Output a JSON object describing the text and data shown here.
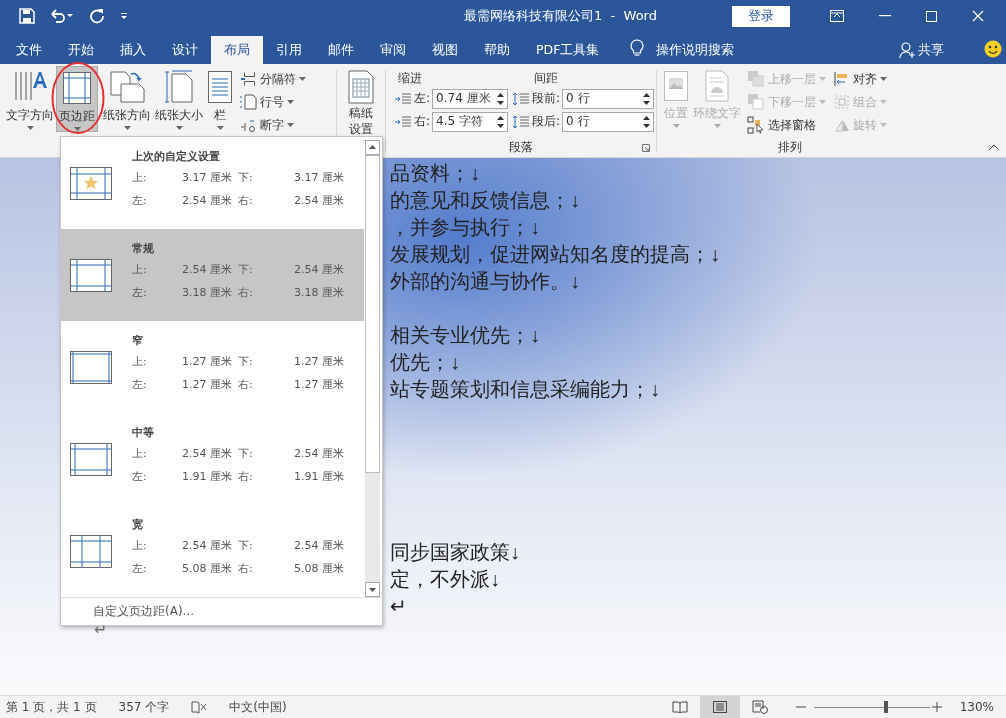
{
  "window": {
    "title": "最需网络科技有限公司1  -  Word",
    "sign_in": "登录"
  },
  "tabs": [
    {
      "label": "文件",
      "selected": false
    },
    {
      "label": "开始",
      "selected": false
    },
    {
      "label": "插入",
      "selected": false
    },
    {
      "label": "设计",
      "selected": false
    },
    {
      "label": "布局",
      "selected": true
    },
    {
      "label": "引用",
      "selected": false
    },
    {
      "label": "邮件",
      "selected": false
    },
    {
      "label": "审阅",
      "selected": false
    },
    {
      "label": "视图",
      "selected": false
    },
    {
      "label": "帮助",
      "selected": false
    },
    {
      "label": "PDF工具集",
      "selected": false
    }
  ],
  "tell_me": "操作说明搜索",
  "share": "共享",
  "page_setup": {
    "big_buttons": [
      {
        "label": "文字方向",
        "kind": "text-direction",
        "pressed": false
      },
      {
        "label": "页边距",
        "kind": "margins",
        "pressed": true
      },
      {
        "label": "纸张方向",
        "kind": "orientation",
        "pressed": false
      },
      {
        "label": "纸张大小",
        "kind": "size",
        "pressed": false
      },
      {
        "label": "栏",
        "kind": "columns",
        "pressed": false
      }
    ],
    "small_buttons": [
      {
        "label": "分隔符",
        "kind": "breaks"
      },
      {
        "label": "行号",
        "kind": "line-numbers"
      },
      {
        "label": "断字",
        "kind": "hyphenation"
      }
    ]
  },
  "manuscript": {
    "lines": [
      "稿纸",
      "设置"
    ]
  },
  "paragraph": {
    "title": "段落",
    "indent": {
      "label": "缩进",
      "fields": [
        {
          "label": "左:",
          "value": "0.74 厘米"
        },
        {
          "label": "右:",
          "value": "4.5 字符"
        }
      ]
    },
    "spacing": {
      "label": "间距",
      "fields": [
        {
          "label": "段前:",
          "value": "0 行"
        },
        {
          "label": "段后:",
          "value": "0 行"
        }
      ]
    }
  },
  "arrange": {
    "title": "排列",
    "big_buttons": [
      {
        "label": "位置",
        "kind": "position",
        "disabled": true
      },
      {
        "label": "环绕文字",
        "kind": "wrap",
        "disabled": true
      }
    ],
    "small_buttons": [
      {
        "label": "上移一层",
        "kind": "forward",
        "disabled": true
      },
      {
        "label": "下移一层",
        "kind": "backward",
        "disabled": true
      },
      {
        "label": "选择窗格",
        "kind": "pane",
        "disabled": false
      }
    ],
    "small_buttons_2": [
      {
        "label": "对齐",
        "kind": "align",
        "disabled": false
      },
      {
        "label": "组合",
        "kind": "group",
        "disabled": true
      },
      {
        "label": "旋转",
        "kind": "rotate",
        "disabled": true
      }
    ]
  },
  "margins_menu": {
    "items": [
      {
        "name": "上次的自定义设置",
        "kind": "custom",
        "selected": false,
        "fields": [
          {
            "label": "上:",
            "value": "3.17 厘米"
          },
          {
            "label": "下:",
            "value": "3.17 厘米"
          },
          {
            "label": "左:",
            "value": "2.54 厘米"
          },
          {
            "label": "右:",
            "value": "2.54 厘米"
          }
        ]
      },
      {
        "name": "常规",
        "kind": "normal",
        "selected": true,
        "fields": [
          {
            "label": "上:",
            "value": "2.54 厘米"
          },
          {
            "label": "下:",
            "value": "2.54 厘米"
          },
          {
            "label": "左:",
            "value": "3.18 厘米"
          },
          {
            "label": "右:",
            "value": "3.18 厘米"
          }
        ]
      },
      {
        "name": "窄",
        "kind": "narrow",
        "selected": false,
        "fields": [
          {
            "label": "上:",
            "value": "1.27 厘米"
          },
          {
            "label": "下:",
            "value": "1.27 厘米"
          },
          {
            "label": "左:",
            "value": "1.27 厘米"
          },
          {
            "label": "右:",
            "value": "1.27 厘米"
          }
        ]
      },
      {
        "name": "中等",
        "kind": "moderate",
        "selected": false,
        "fields": [
          {
            "label": "上:",
            "value": "2.54 厘米"
          },
          {
            "label": "下:",
            "value": "2.54 厘米"
          },
          {
            "label": "左:",
            "value": "1.91 厘米"
          },
          {
            "label": "右:",
            "value": "1.91 厘米"
          }
        ]
      },
      {
        "name": "宽",
        "kind": "wide",
        "selected": false,
        "fields": [
          {
            "label": "上:",
            "value": "2.54 厘米"
          },
          {
            "label": "下:",
            "value": "2.54 厘米"
          },
          {
            "label": "左:",
            "value": "5.08 厘米"
          },
          {
            "label": "右:",
            "value": "5.08 厘米"
          }
        ]
      }
    ],
    "footer": "自定义页边距(A)..."
  },
  "document": {
    "blocks": [
      [
        "品资料；↓",
        "的意见和反馈信息；↓",
        "，并参与执行；↓",
        "发展规划，促进网站知名度的提高；↓",
        "外部的沟通与协作。↓"
      ],
      [
        "相关专业优先；↓",
        "优先；↓",
        "站专题策划和信息采编能力；↓"
      ],
      [
        "同步国家政策↓",
        "定，不外派↓",
        "↵"
      ]
    ],
    "end_mark": "↵"
  },
  "status_bar": {
    "page": "第 1 页，共 1 页",
    "words": "357 个字",
    "language": "中文(中国)",
    "views": [
      {
        "kind": "read",
        "selected": false
      },
      {
        "kind": "print",
        "selected": true
      },
      {
        "kind": "web",
        "selected": false
      }
    ],
    "zoom": {
      "level": 0.62
    },
    "zoom_label": "130%"
  }
}
